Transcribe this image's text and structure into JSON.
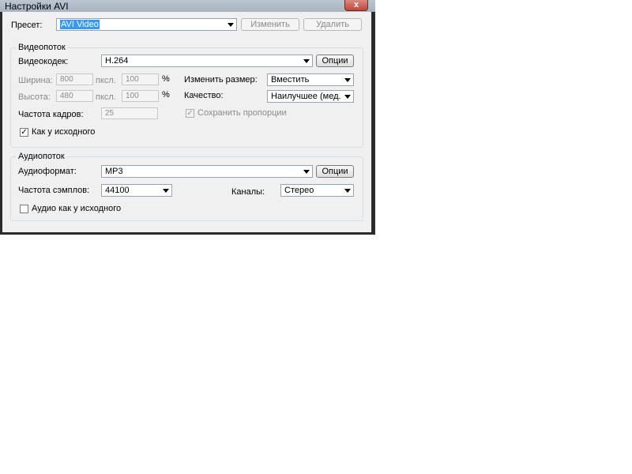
{
  "window": {
    "title": "Настройки AVI",
    "close_glyph": "x"
  },
  "preset": {
    "label": "Пресет:",
    "value": "AVI Video",
    "edit_button": "Изменить",
    "delete_button": "Удалить"
  },
  "video": {
    "group_title": "Видеопоток",
    "codec_label": "Видеокодек:",
    "codec_value": "H.264",
    "options_button": "Опции",
    "width_label": "Ширина:",
    "width_value": "800",
    "width_unit": "пксл.",
    "width_percent": "100",
    "height_label": "Высота:",
    "height_value": "480",
    "height_unit": "пксл.",
    "height_percent": "100",
    "percent_sign": "%",
    "resize_label": "Изменить размер:",
    "resize_value": "Вместить",
    "quality_label": "Качество:",
    "quality_value": "Наилучшее (мед.",
    "keep_proportions_label": "Сохранить пропорции",
    "keep_proportions_checked": true,
    "framerate_label": "Частота кадров:",
    "framerate_value": "25",
    "as_source_label": "Как у исходного",
    "as_source_checked": true,
    "check_glyph": "✓"
  },
  "audio": {
    "group_title": "Аудиопоток",
    "format_label": "Аудиоформат:",
    "format_value": "MP3",
    "options_button": "Опции",
    "samplerate_label": "Частота сэмплов:",
    "samplerate_value": "44100",
    "channels_label": "Каналы:",
    "channels_value": "Стерео",
    "as_source_label": "Аудио как у исходного",
    "as_source_checked": false
  }
}
